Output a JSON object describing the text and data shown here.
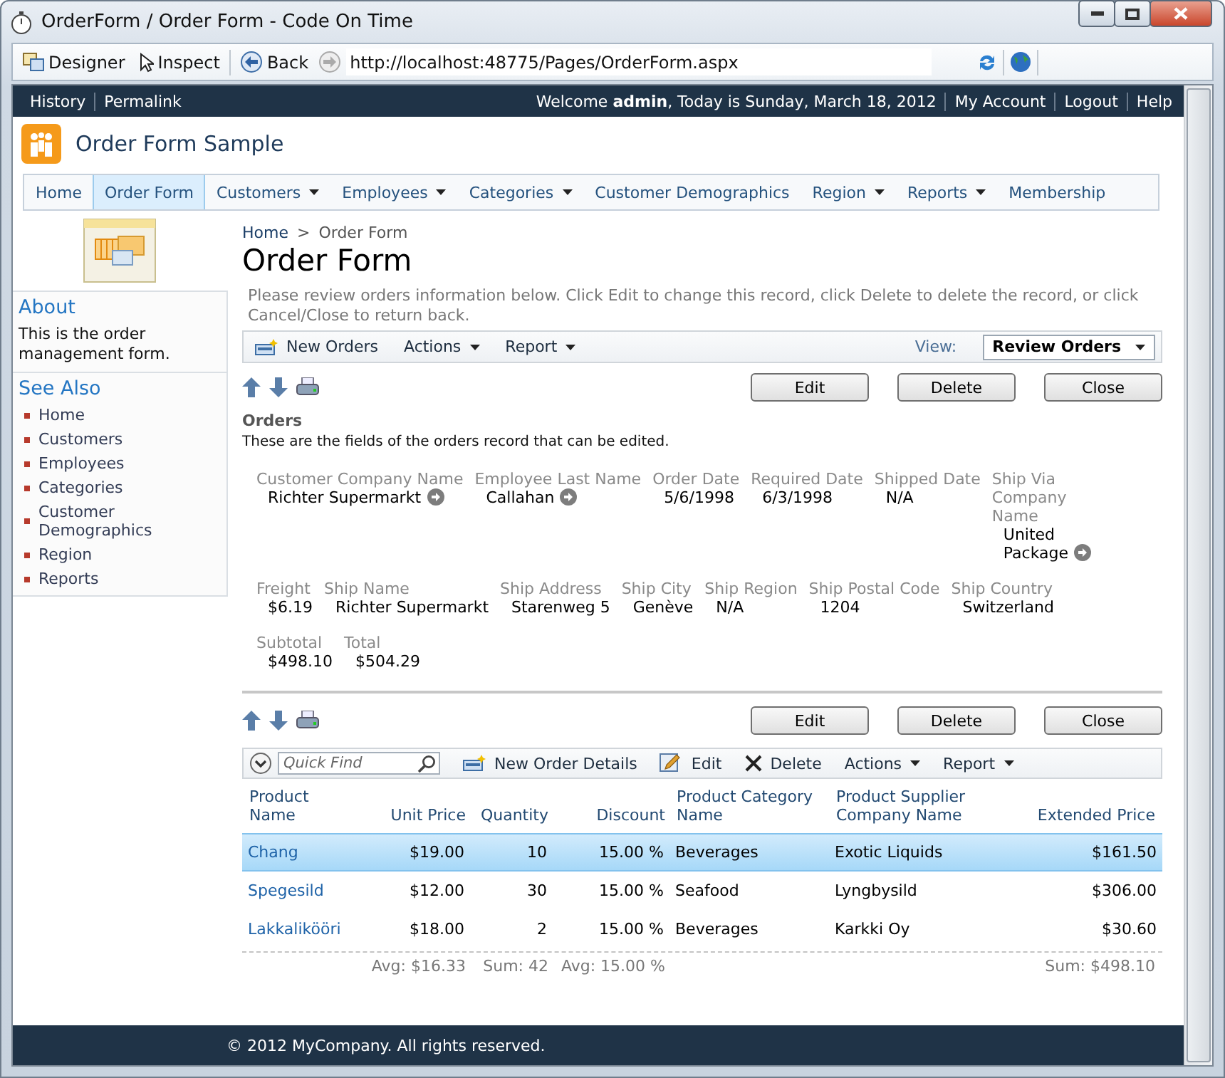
{
  "window": {
    "title": "OrderForm / Order Form - Code On Time"
  },
  "browser_toolbar": {
    "buttons": [
      {
        "label": "Designer",
        "kind": "designer"
      },
      {
        "label": "Inspect",
        "kind": "inspect"
      },
      {
        "label": "Back",
        "kind": "back"
      }
    ],
    "address": "http://localhost:48775/Pages/OrderForm.aspx"
  },
  "top_bar": {
    "left_links": [
      "History",
      "Permalink"
    ],
    "welcome": "Welcome **admin**, Today is Sunday, March 18, 2012",
    "right_links": [
      "My Account",
      "Logout",
      "Help"
    ]
  },
  "site": {
    "title": "Order Form Sample"
  },
  "menu": [
    {
      "label": "Home",
      "selected": false,
      "dropdown": false
    },
    {
      "label": "Order Form",
      "selected": true,
      "dropdown": false
    },
    {
      "label": "Customers",
      "selected": false,
      "dropdown": true
    },
    {
      "label": "Employees",
      "selected": false,
      "dropdown": true
    },
    {
      "label": "Categories",
      "selected": false,
      "dropdown": true
    },
    {
      "label": "Customer Demographics",
      "selected": false,
      "dropdown": false
    },
    {
      "label": "Region",
      "selected": false,
      "dropdown": true
    },
    {
      "label": "Reports",
      "selected": false,
      "dropdown": true
    },
    {
      "label": "Membership",
      "selected": false,
      "dropdown": false
    }
  ],
  "sidebar": {
    "about_title": "About",
    "about_text": "This is the order management form.",
    "see_also_title": "See Also",
    "links": [
      "Home",
      "Customers",
      "Employees",
      "Categories",
      "Customer Demographics",
      "Region",
      "Reports"
    ]
  },
  "breadcrumb": {
    "items": [
      "Home",
      "Order Form"
    ],
    "separator": ">"
  },
  "page_title": "Order Form",
  "description": "Please review orders information below. Click Edit to change this record, click Delete to delete the record, or click Cancel/Close to return back.",
  "action_bar": {
    "items": [
      {
        "label": "New Orders",
        "kind": "new"
      },
      {
        "label": "Actions",
        "kind": "menu"
      },
      {
        "label": "Report",
        "kind": "menu"
      }
    ],
    "view_label": "View:",
    "view": "Review Orders"
  },
  "form": {
    "buttons": [
      "Edit",
      "Delete",
      "Close"
    ],
    "title": "Orders",
    "subtitle": "These are the fields of the orders record that can be edited.",
    "rows": [
      {
        "fields": [
          {
            "label": "Customer Company Name",
            "value": "Richter Supermarkt",
            "lookup": true,
            "narrow": false
          },
          {
            "label": "Employee Last Name",
            "value": "Callahan",
            "lookup": true,
            "narrow": false
          },
          {
            "label": "Order Date",
            "value": "5/6/1998",
            "lookup": false,
            "narrow": false
          },
          {
            "label": "Required Date",
            "value": "6/3/1998",
            "lookup": false,
            "narrow": false
          },
          {
            "label": "Shipped Date",
            "value": "N/A",
            "lookup": false,
            "narrow": false
          },
          {
            "label": "Ship Via Company Name",
            "value": "United Package",
            "lookup": true,
            "narrow": true
          }
        ]
      },
      {
        "fields": [
          {
            "label": "Freight",
            "value": "$6.19",
            "lookup": false,
            "narrow": false
          },
          {
            "label": "Ship Name",
            "value": "Richter Supermarkt",
            "lookup": false,
            "narrow": false
          },
          {
            "label": "Ship Address",
            "value": "Starenweg 5",
            "lookup": false,
            "narrow": false
          },
          {
            "label": "Ship City",
            "value": "Genève",
            "lookup": false,
            "narrow": false
          },
          {
            "label": "Ship Region",
            "value": "N/A",
            "lookup": false,
            "narrow": false
          },
          {
            "label": "Ship Postal Code",
            "value": "1204",
            "lookup": false,
            "narrow": false
          },
          {
            "label": "Ship Country",
            "value": "Switzerland",
            "lookup": false,
            "narrow": true
          }
        ]
      },
      {
        "fields": [
          {
            "label": "Subtotal",
            "value": "$498.10",
            "lookup": false,
            "narrow": false
          },
          {
            "label": "Total",
            "value": "$504.29",
            "lookup": false,
            "narrow": false
          }
        ]
      }
    ]
  },
  "details": {
    "buttons": [
      "Edit",
      "Delete",
      "Close"
    ],
    "quick_find_placeholder": "Quick Find",
    "toolbar": [
      {
        "label": "New Order Details",
        "kind": "new"
      },
      {
        "label": "Edit",
        "kind": "edit"
      },
      {
        "label": "Delete",
        "kind": "delete"
      },
      {
        "label": "Actions",
        "kind": "menu"
      },
      {
        "label": "Report",
        "kind": "menu"
      }
    ],
    "columns": [
      {
        "label": "Product Name",
        "kind": "link"
      },
      {
        "label": "Unit Price",
        "kind": "number"
      },
      {
        "label": "Quantity",
        "kind": "number"
      },
      {
        "label": "Discount",
        "kind": "number"
      },
      {
        "label": "Product Category Name",
        "kind": "text"
      },
      {
        "label": "Product Supplier Company Name",
        "kind": "text"
      },
      {
        "label": "Extended Price",
        "kind": "number"
      }
    ],
    "rows": [
      {
        "selected": true,
        "cells": [
          "Chang",
          "$19.00",
          "10",
          "15.00 %",
          "Beverages",
          "Exotic Liquids",
          "$161.50"
        ]
      },
      {
        "selected": false,
        "cells": [
          "Spegesild",
          "$12.00",
          "30",
          "15.00 %",
          "Seafood",
          "Lyngbysild",
          "$306.00"
        ]
      },
      {
        "selected": false,
        "cells": [
          "Lakkalikööri",
          "$18.00",
          "2",
          "15.00 %",
          "Beverages",
          "Karkki Oy",
          "$30.60"
        ]
      }
    ],
    "totals": [
      "Avg: $16.33",
      "Sum: 42",
      "Avg: 15.00 %",
      "Sum: $498.10"
    ]
  },
  "footer": "© 2012 MyCompany. All rights reserved."
}
